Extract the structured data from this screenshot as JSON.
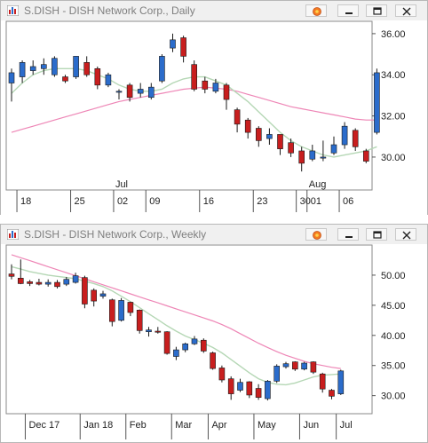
{
  "colors": {
    "up": "#2b6ccb",
    "down": "#c81e1e",
    "wick": "#1a1a1a",
    "ma_fast": "#b5d7b5",
    "ma_slow": "#ee86b6",
    "grid": "#cfcfcf"
  },
  "icons": {
    "chart_icon": "chart-icon",
    "fire_icon": "fire-icon",
    "minimize_icon": "minimize-icon",
    "maximize_icon": "maximize-icon",
    "close_icon": "close-icon"
  },
  "panels": [
    {
      "title": "S.DISH - DISH Network Corp., Daily"
    },
    {
      "title": "S.DISH - DISH Network Corp., Weekly"
    }
  ],
  "chart_data": [
    {
      "type": "candlestick",
      "title": "S.DISH - DISH Network Corp., Daily",
      "ylim": [
        28.4,
        36.6
      ],
      "y_ticks": [
        "36.00",
        "34.00",
        "32.00",
        "30.00"
      ],
      "y_tick_values": [
        36,
        34,
        32,
        30
      ],
      "x_ticks": [
        {
          "label": "18",
          "index": 1
        },
        {
          "label": "25",
          "index": 6
        },
        {
          "label": "02",
          "index": 10
        },
        {
          "label": "09",
          "index": 13
        },
        {
          "label": "16",
          "index": 18
        },
        {
          "label": "23",
          "index": 23
        },
        {
          "label": "30",
          "index": 27
        },
        {
          "label": "01",
          "index": 28
        },
        {
          "label": "06",
          "index": 31
        }
      ],
      "period_labels": [
        {
          "label": "Jul",
          "index": 10
        },
        {
          "label": "Aug",
          "index": 28
        }
      ],
      "candles": [
        {
          "o": 33.6,
          "h": 34.3,
          "l": 32.7,
          "c": 34.1
        },
        {
          "o": 33.9,
          "h": 34.7,
          "l": 33.6,
          "c": 34.6
        },
        {
          "o": 34.2,
          "h": 34.7,
          "l": 34.0,
          "c": 34.4
        },
        {
          "o": 34.3,
          "h": 34.8,
          "l": 34.0,
          "c": 34.5
        },
        {
          "o": 34.0,
          "h": 34.9,
          "l": 33.9,
          "c": 34.8
        },
        {
          "o": 33.9,
          "h": 34.0,
          "l": 33.6,
          "c": 33.7
        },
        {
          "o": 33.9,
          "h": 34.9,
          "l": 33.8,
          "c": 34.9
        },
        {
          "o": 34.6,
          "h": 34.9,
          "l": 33.9,
          "c": 34.0
        },
        {
          "o": 34.3,
          "h": 34.4,
          "l": 33.3,
          "c": 33.5
        },
        {
          "o": 33.5,
          "h": 34.1,
          "l": 33.4,
          "c": 34.0
        },
        {
          "o": 33.2,
          "h": 33.3,
          "l": 32.8,
          "c": 33.2
        },
        {
          "o": 33.5,
          "h": 33.6,
          "l": 32.7,
          "c": 32.9
        },
        {
          "o": 33.1,
          "h": 33.6,
          "l": 32.9,
          "c": 33.3
        },
        {
          "o": 32.9,
          "h": 33.6,
          "l": 32.8,
          "c": 33.4
        },
        {
          "o": 33.7,
          "h": 35.0,
          "l": 33.6,
          "c": 34.9
        },
        {
          "o": 35.3,
          "h": 36.0,
          "l": 35.1,
          "c": 35.7
        },
        {
          "o": 35.8,
          "h": 35.9,
          "l": 34.6,
          "c": 34.9
        },
        {
          "o": 34.5,
          "h": 34.7,
          "l": 33.2,
          "c": 33.3
        },
        {
          "o": 33.7,
          "h": 33.9,
          "l": 33.1,
          "c": 33.3
        },
        {
          "o": 33.2,
          "h": 33.8,
          "l": 33.1,
          "c": 33.6
        },
        {
          "o": 33.5,
          "h": 33.6,
          "l": 32.3,
          "c": 32.8
        },
        {
          "o": 32.3,
          "h": 32.4,
          "l": 31.2,
          "c": 31.6
        },
        {
          "o": 31.8,
          "h": 31.9,
          "l": 30.9,
          "c": 31.2
        },
        {
          "o": 31.4,
          "h": 31.5,
          "l": 30.5,
          "c": 30.8
        },
        {
          "o": 30.9,
          "h": 31.4,
          "l": 30.6,
          "c": 31.1
        },
        {
          "o": 31.1,
          "h": 31.1,
          "l": 30.1,
          "c": 30.4
        },
        {
          "o": 30.7,
          "h": 30.9,
          "l": 30.0,
          "c": 30.2
        },
        {
          "o": 30.3,
          "h": 30.5,
          "l": 29.3,
          "c": 29.7
        },
        {
          "o": 29.9,
          "h": 30.6,
          "l": 29.8,
          "c": 30.3
        },
        {
          "o": 30.0,
          "h": 30.8,
          "l": 29.8,
          "c": 30.0
        },
        {
          "o": 30.2,
          "h": 31.0,
          "l": 30.1,
          "c": 30.6
        },
        {
          "o": 30.6,
          "h": 31.7,
          "l": 30.4,
          "c": 31.5
        },
        {
          "o": 31.3,
          "h": 31.4,
          "l": 30.3,
          "c": 30.5
        },
        {
          "o": 30.3,
          "h": 30.4,
          "l": 29.7,
          "c": 29.8
        },
        {
          "o": 31.2,
          "h": 34.3,
          "l": 31.1,
          "c": 34.1
        }
      ],
      "ma_fast": [
        33.1,
        33.6,
        34.0,
        34.2,
        34.3,
        34.3,
        34.3,
        34.2,
        34.0,
        33.8,
        33.5,
        33.3,
        33.2,
        33.2,
        33.3,
        33.6,
        33.8,
        33.9,
        33.9,
        33.7,
        33.5,
        33.1,
        32.7,
        32.2,
        31.7,
        31.2,
        30.8,
        30.5,
        30.3,
        30.1,
        30.0,
        30.1,
        30.2,
        30.3,
        30.5
      ],
      "ma_slow": [
        31.2,
        31.35,
        31.5,
        31.65,
        31.8,
        31.95,
        32.1,
        32.25,
        32.4,
        32.55,
        32.7,
        32.8,
        32.9,
        33.0,
        33.1,
        33.2,
        33.3,
        33.35,
        33.4,
        33.35,
        33.3,
        33.2,
        33.05,
        32.9,
        32.75,
        32.6,
        32.45,
        32.35,
        32.25,
        32.15,
        32.05,
        31.95,
        31.85,
        31.8,
        31.8
      ]
    },
    {
      "type": "candlestick",
      "title": "S.DISH - DISH Network Corp., Weekly",
      "ylim": [
        27.0,
        55.0
      ],
      "y_ticks": [
        "50.00",
        "45.00",
        "40.00",
        "35.00",
        "30.00"
      ],
      "y_tick_values": [
        50,
        45,
        40,
        35,
        30
      ],
      "x_ticks": [
        {
          "label": "Dec 17",
          "index": 2
        },
        {
          "label": "Jan 18",
          "index": 8
        },
        {
          "label": "Feb",
          "index": 13
        },
        {
          "label": "Mar",
          "index": 18
        },
        {
          "label": "Apr",
          "index": 22
        },
        {
          "label": "May",
          "index": 27
        },
        {
          "label": "Jun",
          "index": 32
        },
        {
          "label": "Jul",
          "index": 36
        }
      ],
      "period_labels": [],
      "candles": [
        {
          "o": 50.2,
          "h": 51.8,
          "l": 49.3,
          "c": 49.8
        },
        {
          "o": 49.5,
          "h": 52.6,
          "l": 48.5,
          "c": 48.6
        },
        {
          "o": 48.9,
          "h": 49.2,
          "l": 48.2,
          "c": 48.6
        },
        {
          "o": 48.8,
          "h": 49.4,
          "l": 48.3,
          "c": 48.5
        },
        {
          "o": 48.5,
          "h": 49.3,
          "l": 48.1,
          "c": 48.8
        },
        {
          "o": 48.8,
          "h": 49.2,
          "l": 47.8,
          "c": 48.1
        },
        {
          "o": 48.5,
          "h": 49.7,
          "l": 48.2,
          "c": 49.3
        },
        {
          "o": 48.8,
          "h": 50.4,
          "l": 48.6,
          "c": 49.9
        },
        {
          "o": 49.6,
          "h": 49.9,
          "l": 44.5,
          "c": 45.2
        },
        {
          "o": 47.5,
          "h": 47.8,
          "l": 44.8,
          "c": 45.7
        },
        {
          "o": 46.5,
          "h": 47.4,
          "l": 46.1,
          "c": 46.9
        },
        {
          "o": 45.9,
          "h": 46.1,
          "l": 41.5,
          "c": 42.3
        },
        {
          "o": 42.5,
          "h": 46.2,
          "l": 42.3,
          "c": 45.8
        },
        {
          "o": 45.5,
          "h": 45.6,
          "l": 43.2,
          "c": 43.8
        },
        {
          "o": 44.2,
          "h": 44.3,
          "l": 40.3,
          "c": 40.8
        },
        {
          "o": 40.6,
          "h": 41.4,
          "l": 39.8,
          "c": 40.9
        },
        {
          "o": 40.7,
          "h": 41.4,
          "l": 40.3,
          "c": 40.6
        },
        {
          "o": 40.6,
          "h": 40.7,
          "l": 36.8,
          "c": 37.0
        },
        {
          "o": 36.5,
          "h": 38.1,
          "l": 35.9,
          "c": 37.6
        },
        {
          "o": 37.6,
          "h": 38.8,
          "l": 37.2,
          "c": 38.6
        },
        {
          "o": 38.6,
          "h": 39.9,
          "l": 38.4,
          "c": 39.4
        },
        {
          "o": 39.2,
          "h": 39.5,
          "l": 37.1,
          "c": 37.4
        },
        {
          "o": 37.1,
          "h": 37.3,
          "l": 34.3,
          "c": 34.5
        },
        {
          "o": 34.6,
          "h": 35.0,
          "l": 32.2,
          "c": 32.6
        },
        {
          "o": 32.8,
          "h": 33.2,
          "l": 29.3,
          "c": 30.3
        },
        {
          "o": 30.9,
          "h": 32.8,
          "l": 30.6,
          "c": 32.2
        },
        {
          "o": 32.3,
          "h": 32.4,
          "l": 29.6,
          "c": 30.1
        },
        {
          "o": 31.2,
          "h": 31.9,
          "l": 29.3,
          "c": 29.7
        },
        {
          "o": 29.5,
          "h": 32.6,
          "l": 29.2,
          "c": 32.4
        },
        {
          "o": 32.4,
          "h": 35.2,
          "l": 32.1,
          "c": 34.9
        },
        {
          "o": 34.8,
          "h": 35.6,
          "l": 34.5,
          "c": 35.3
        },
        {
          "o": 35.6,
          "h": 35.7,
          "l": 34.1,
          "c": 34.4
        },
        {
          "o": 34.4,
          "h": 35.6,
          "l": 34.2,
          "c": 35.4
        },
        {
          "o": 35.6,
          "h": 35.7,
          "l": 33.6,
          "c": 33.9
        },
        {
          "o": 33.6,
          "h": 33.8,
          "l": 30.5,
          "c": 31.1
        },
        {
          "o": 30.9,
          "h": 31.1,
          "l": 29.4,
          "c": 29.9
        },
        {
          "o": 30.3,
          "h": 34.3,
          "l": 30.1,
          "c": 34.1
        }
      ],
      "ma_fast": [
        51.4,
        51.0,
        50.6,
        50.3,
        50.0,
        49.8,
        49.6,
        49.4,
        49.0,
        48.6,
        48.1,
        47.4,
        46.5,
        45.6,
        44.6,
        43.6,
        42.6,
        41.6,
        40.7,
        39.9,
        39.3,
        38.7,
        38.0,
        37.1,
        36.0,
        34.9,
        33.8,
        32.8,
        32.2,
        31.9,
        31.8,
        32.1,
        32.6,
        33.1,
        33.4,
        33.5,
        33.6
      ],
      "ma_slow": [
        53.4,
        52.9,
        52.4,
        51.9,
        51.4,
        50.9,
        50.4,
        49.9,
        49.4,
        48.9,
        48.4,
        47.9,
        47.4,
        46.9,
        46.4,
        45.9,
        45.4,
        44.9,
        44.4,
        43.9,
        43.4,
        42.9,
        42.4,
        41.8,
        41.1,
        40.3,
        39.5,
        38.7,
        38.0,
        37.3,
        36.7,
        36.2,
        35.7,
        35.3,
        35.0,
        34.7,
        34.5
      ]
    }
  ]
}
